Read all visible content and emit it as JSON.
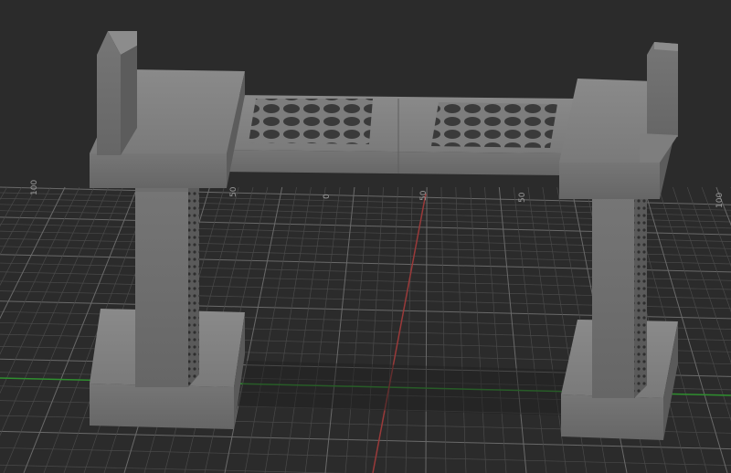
{
  "viewport": {
    "background_color": "#2b2b2b",
    "grid_color": "#6a6a6a",
    "grid_minor_color": "#4a4a4a",
    "x_axis_color": "#2f8f2f",
    "y_axis_color": "#9a3a3a",
    "model_color": "#7a7a7a"
  },
  "grid_labels": {
    "a": "100",
    "b": "50",
    "c": "0",
    "d": "50",
    "e": "50",
    "f": "100"
  },
  "model": {
    "parts": [
      "left-support",
      "right-support",
      "left-leg",
      "right-leg",
      "left-base",
      "right-base",
      "top-bridge",
      "left-mesh-panel",
      "right-mesh-panel"
    ]
  }
}
